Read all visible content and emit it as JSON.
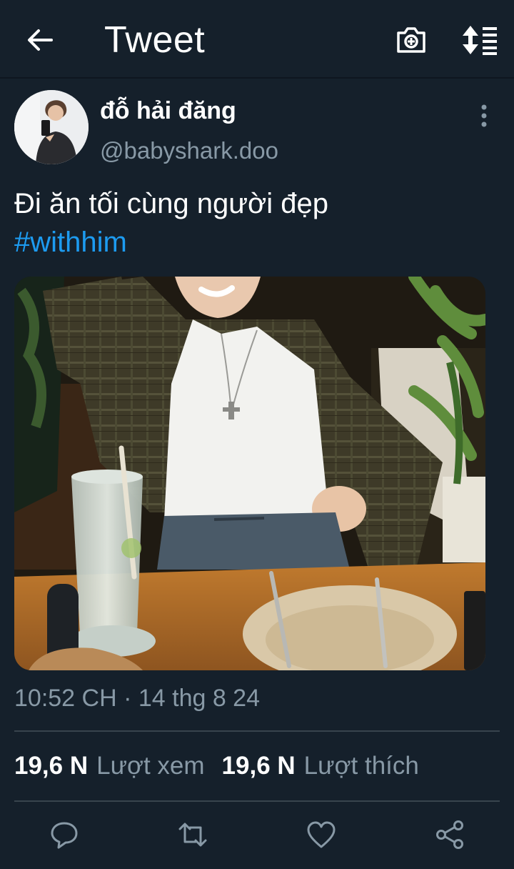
{
  "header": {
    "title": "Tweet",
    "back_icon": "arrow-left-icon",
    "camera_icon": "camera-plus-icon",
    "sort_icon": "sort-list-icon"
  },
  "tweet": {
    "display_name": "đỗ hải đăng",
    "handle": "@babyshark.doo",
    "text": "Đi ăn tối cùng người đẹp",
    "hashtag": "#withhim",
    "timestamp": "10:52 CH · 14 thg 8 24"
  },
  "stats": {
    "views_count": "19,6 N",
    "views_label": "Lượt xem",
    "likes_count": "19,6 N",
    "likes_label": "Lượt thích"
  },
  "actions": [
    "reply-icon",
    "retweet-icon",
    "like-icon",
    "share-icon"
  ],
  "colors": {
    "background": "#15202b",
    "accent": "#1d9bf0",
    "secondary_text": "#8899a6",
    "divider": "#38444d"
  }
}
